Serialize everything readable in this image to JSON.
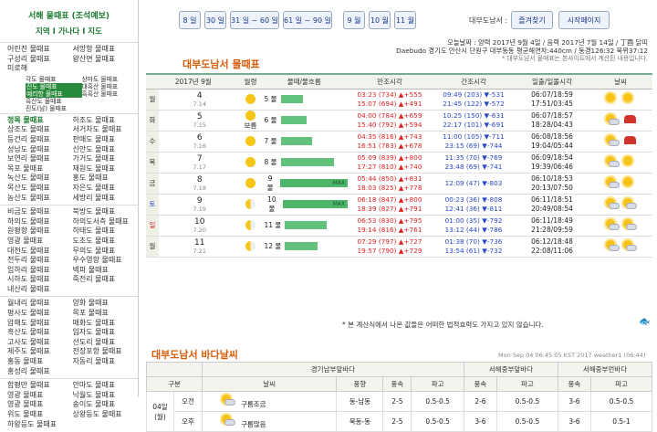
{
  "sidebar": {
    "title": "서해 물때표 (조석예보)",
    "nav": "지역 I 가나다 I 지도",
    "groups": [
      {
        "left": [
          "어린진 물때표",
          "구성리 물때표",
          "미로해"
        ],
        "right": [
          "서망항 물때표",
          "왕산면 물때표",
          ""
        ]
      },
      {
        "left": [
          "정목 물때표",
          "상조도 물때표",
          "등건리 물때표",
          "성남도 물때표",
          "보연리 물때표",
          "목포 물때표",
          "녹산도 물때표",
          "목산도 물때표",
          "농산도 물때표"
        ],
        "right": [
          "하조도 물때표",
          "서거차도 물때표",
          "판매도 물때표",
          "신안도 물때표",
          "가거도 물때표",
          "재원도 물때표",
          "홍도 물때표",
          "자은도 물때표",
          "세방리 물때표"
        ]
      },
      {
        "left": [
          "비금도 물때표",
          "하의도 물때표",
          "원평항 물때표",
          "영광 물때표",
          "대천도 물때표",
          "전두리 물때표",
          "임하리 물때표",
          "시하도 물때표",
          "내산리 물때표"
        ],
        "right": [
          "북방도 물때표",
          "하의도서측 물때표",
          "하태도 물때표",
          "도초도 물때표",
          "무의도 물때표",
          "우수영항 물때표",
          "벽파 물때표",
          "죽전리 물때표",
          ""
        ]
      },
      {
        "left": [
          "월내리 물때표",
          "평사도 물때표",
          "압해도 물때표",
          "흑산도 물때표",
          "고사도 물때표",
          "제주도 물때표",
          "홍동 물때표",
          "홍성리 물때표"
        ],
        "right": [
          "양화 물때표",
          "목포 물때표",
          "매화도 물때표",
          "임자도 물때표",
          "선도리 물때표",
          "전장포항 물때표",
          "자동리 물때표",
          ""
        ]
      },
      {
        "left": [
          "함평만 물때표",
          "영광 물때표",
          "영광 물때표",
          "위도 물때표",
          "하왕등도 물때표"
        ],
        "right": [
          "안마도 물때표",
          "낙월도 물때표",
          "송이도 물때표",
          "상왕등도 물때표",
          ""
        ]
      }
    ],
    "small": {
      "left": [
        "각도 물때표",
        "진도 물때표",
        "예리항 물때표",
        "흑산도 물때표",
        "진도(남) 물때표"
      ],
      "right": [
        "상마도 물때표",
        "대흑산 물때표",
        "흑흑산 물때표",
        "",
        ""
      ]
    }
  },
  "topnav": {
    "days": [
      "8 일",
      "30 일",
      "31 일 ~ 60 일",
      "61 일 ~ 90 일",
      "9 월",
      "10 월",
      "11 월"
    ],
    "label": "대부도남서 :",
    "fav": "즐겨찾기",
    "home": "시작페이지"
  },
  "info": [
    "오늘날짜 : 양력 2017년 9월 4일 / 음력 2017년 7월 14일 / 丁酉 닭띠",
    "Daebudo 경기도 안산시 단원구 대부동동 평균해면차:440cm / 동경126:32 북위37:12",
    "* 대부도남서 물때표는 본사이트에서 계산된 내용입니다."
  ],
  "tide": {
    "title": "대부도남서 물때표",
    "headers": [
      "2017년 9월",
      "월령",
      "물때/물흐름",
      "만조시각",
      "간조시각",
      "일출/일몰시각",
      "날씨"
    ],
    "rows": [
      {
        "d": "4",
        "l": "7.14",
        "dw": "월",
        "dc": "",
        "moon": "full",
        "mul": "5 물",
        "bar": 24,
        "hi": [
          "03:23 (734) ▲+555",
          "15:07 (694) ▲+491"
        ],
        "lo": [
          "09:49 (203) ▼-531",
          "21:45 (122) ▼-572"
        ],
        "sun": [
          "06:07/18:59",
          "17:51/03:45"
        ],
        "wx": [
          "sun",
          "sun"
        ]
      },
      {
        "d": "5",
        "l": "7.15",
        "dw": "화",
        "dc": "",
        "moon": "full",
        "moonlbl": "보름",
        "mul": "6 물",
        "bar": 28,
        "hi": [
          "04:00 (784) ▲+659",
          "15:40 (792) ▲+594"
        ],
        "lo": [
          "10:25 (150) ▼-631",
          "22:17 (101) ▼-691"
        ],
        "sun": [
          "06:07/18:57",
          "18:28/04:43"
        ],
        "wx": [
          "cloud",
          "rain"
        ]
      },
      {
        "d": "6",
        "l": "7.16",
        "dw": "수",
        "dc": "",
        "moon": "full",
        "mul": "7 물",
        "bar": 34,
        "hi": [
          "04:35 (816) ▲+743",
          "16:51 (783) ▲+678"
        ],
        "lo": [
          "11:00 (105) ▼-711",
          "23:15 (69) ▼-744"
        ],
        "sun": [
          "06:08/18:56",
          "19:04/05:44"
        ],
        "wx": [
          "cloud",
          "rain"
        ]
      },
      {
        "d": "7",
        "l": "7.17",
        "dw": "목",
        "dc": "",
        "moon": "full",
        "mul": "8 물",
        "bar": 58,
        "hi": [
          "05:09 (839) ▲+800",
          "17:27 (810) ▲+740"
        ],
        "lo": [
          "11:35 (70) ▼-769",
          "23:48 (69) ▼-741"
        ],
        "sun": [
          "06:09/18:54",
          "19:39/06:46"
        ],
        "wx": [
          "cloud",
          "sun"
        ]
      },
      {
        "d": "8",
        "l": "7.18",
        "dw": "금",
        "dc": "",
        "moon": "full",
        "mul": "9 물",
        "bar": 78,
        "maxlbl": "MAX",
        "hi": [
          "05:44 (850) ▲+831",
          "18:03 (825) ▲+778"
        ],
        "lo": [
          "12:09 (47) ▼-803"
        ],
        "sun": [
          "06:10/18:53",
          "20:13/07:50"
        ],
        "wx": [
          "cloud",
          "sun"
        ]
      },
      {
        "d": "9",
        "l": "7.19",
        "dw": "토",
        "dc": "sat",
        "moon": "half",
        "mul": "10 물",
        "bar": 78,
        "maxlbl": "MAX",
        "hi": [
          "06:18 (847) ▲+800",
          "18:39 (827) ▲+791"
        ],
        "lo": [
          "00:23 (36) ▼-808",
          "12:41 (36) ▼-811"
        ],
        "sun": [
          "06:11/18:51",
          "20:49/08:54"
        ],
        "wx": [
          "cloud",
          "cloud"
        ]
      },
      {
        "d": "10",
        "l": "7.20",
        "dw": "일",
        "dc": "sun",
        "moon": "half",
        "mul": "11 물",
        "bar": 46,
        "hi": [
          "06:53 (830) ▲+795",
          "19:14 (816) ▲+761"
        ],
        "lo": [
          "01:00 (35) ▼-792",
          "13:12 (44) ▼-786"
        ],
        "sun": [
          "06:11/18:49",
          "21:28/09:59"
        ],
        "wx": [
          "cloud",
          "cloud"
        ]
      },
      {
        "d": "11",
        "l": "7.21",
        "dw": "월",
        "dc": "",
        "moon": "half",
        "mul": "12 물",
        "bar": 36,
        "hi": [
          "07:29 (797) ▲+727",
          "19:57 (790) ▲+729"
        ],
        "lo": [
          "01:38 (70) ▼-736",
          "13:54 (61) ▼-732"
        ],
        "sun": [
          "06:12/18:48",
          "22:08/11:06"
        ],
        "wx": [
          "cloud",
          "cloud"
        ]
      }
    ],
    "footnote": "* 본 계산식에서 나온 값들은 어떠한 법적효력도 가지고 있지 않습니다."
  },
  "sea": {
    "title": "대부도남서 바다날씨",
    "timestamp": "Mon Sep 04 06:45:05 KST 2017 weather1 (06:44)",
    "groups": [
      "경기남부앞바다",
      "서해중부앞바다",
      "서해중부먼바다"
    ],
    "headers": [
      "구분",
      "날씨",
      "풍향",
      "풍속",
      "파고",
      "풍속",
      "파고",
      "풍속",
      "파고"
    ],
    "date": "04일(월)",
    "rows": [
      {
        "time": "오전",
        "wx": "구름조금",
        "dir": "동-남동",
        "s1": "2-5",
        "w1": "0.5-0.5",
        "s2": "2-6",
        "w2": "0.5-0.5",
        "s3": "3-6",
        "w3": "0.5-0.5"
      },
      {
        "time": "오후",
        "wx": "구름많음",
        "dir": "북동-동",
        "s1": "2-5",
        "w1": "0.5-0.5",
        "s2": "3-6",
        "w2": "0.5-0.5",
        "s3": "3-6",
        "w3": "0.5-1"
      }
    ]
  }
}
